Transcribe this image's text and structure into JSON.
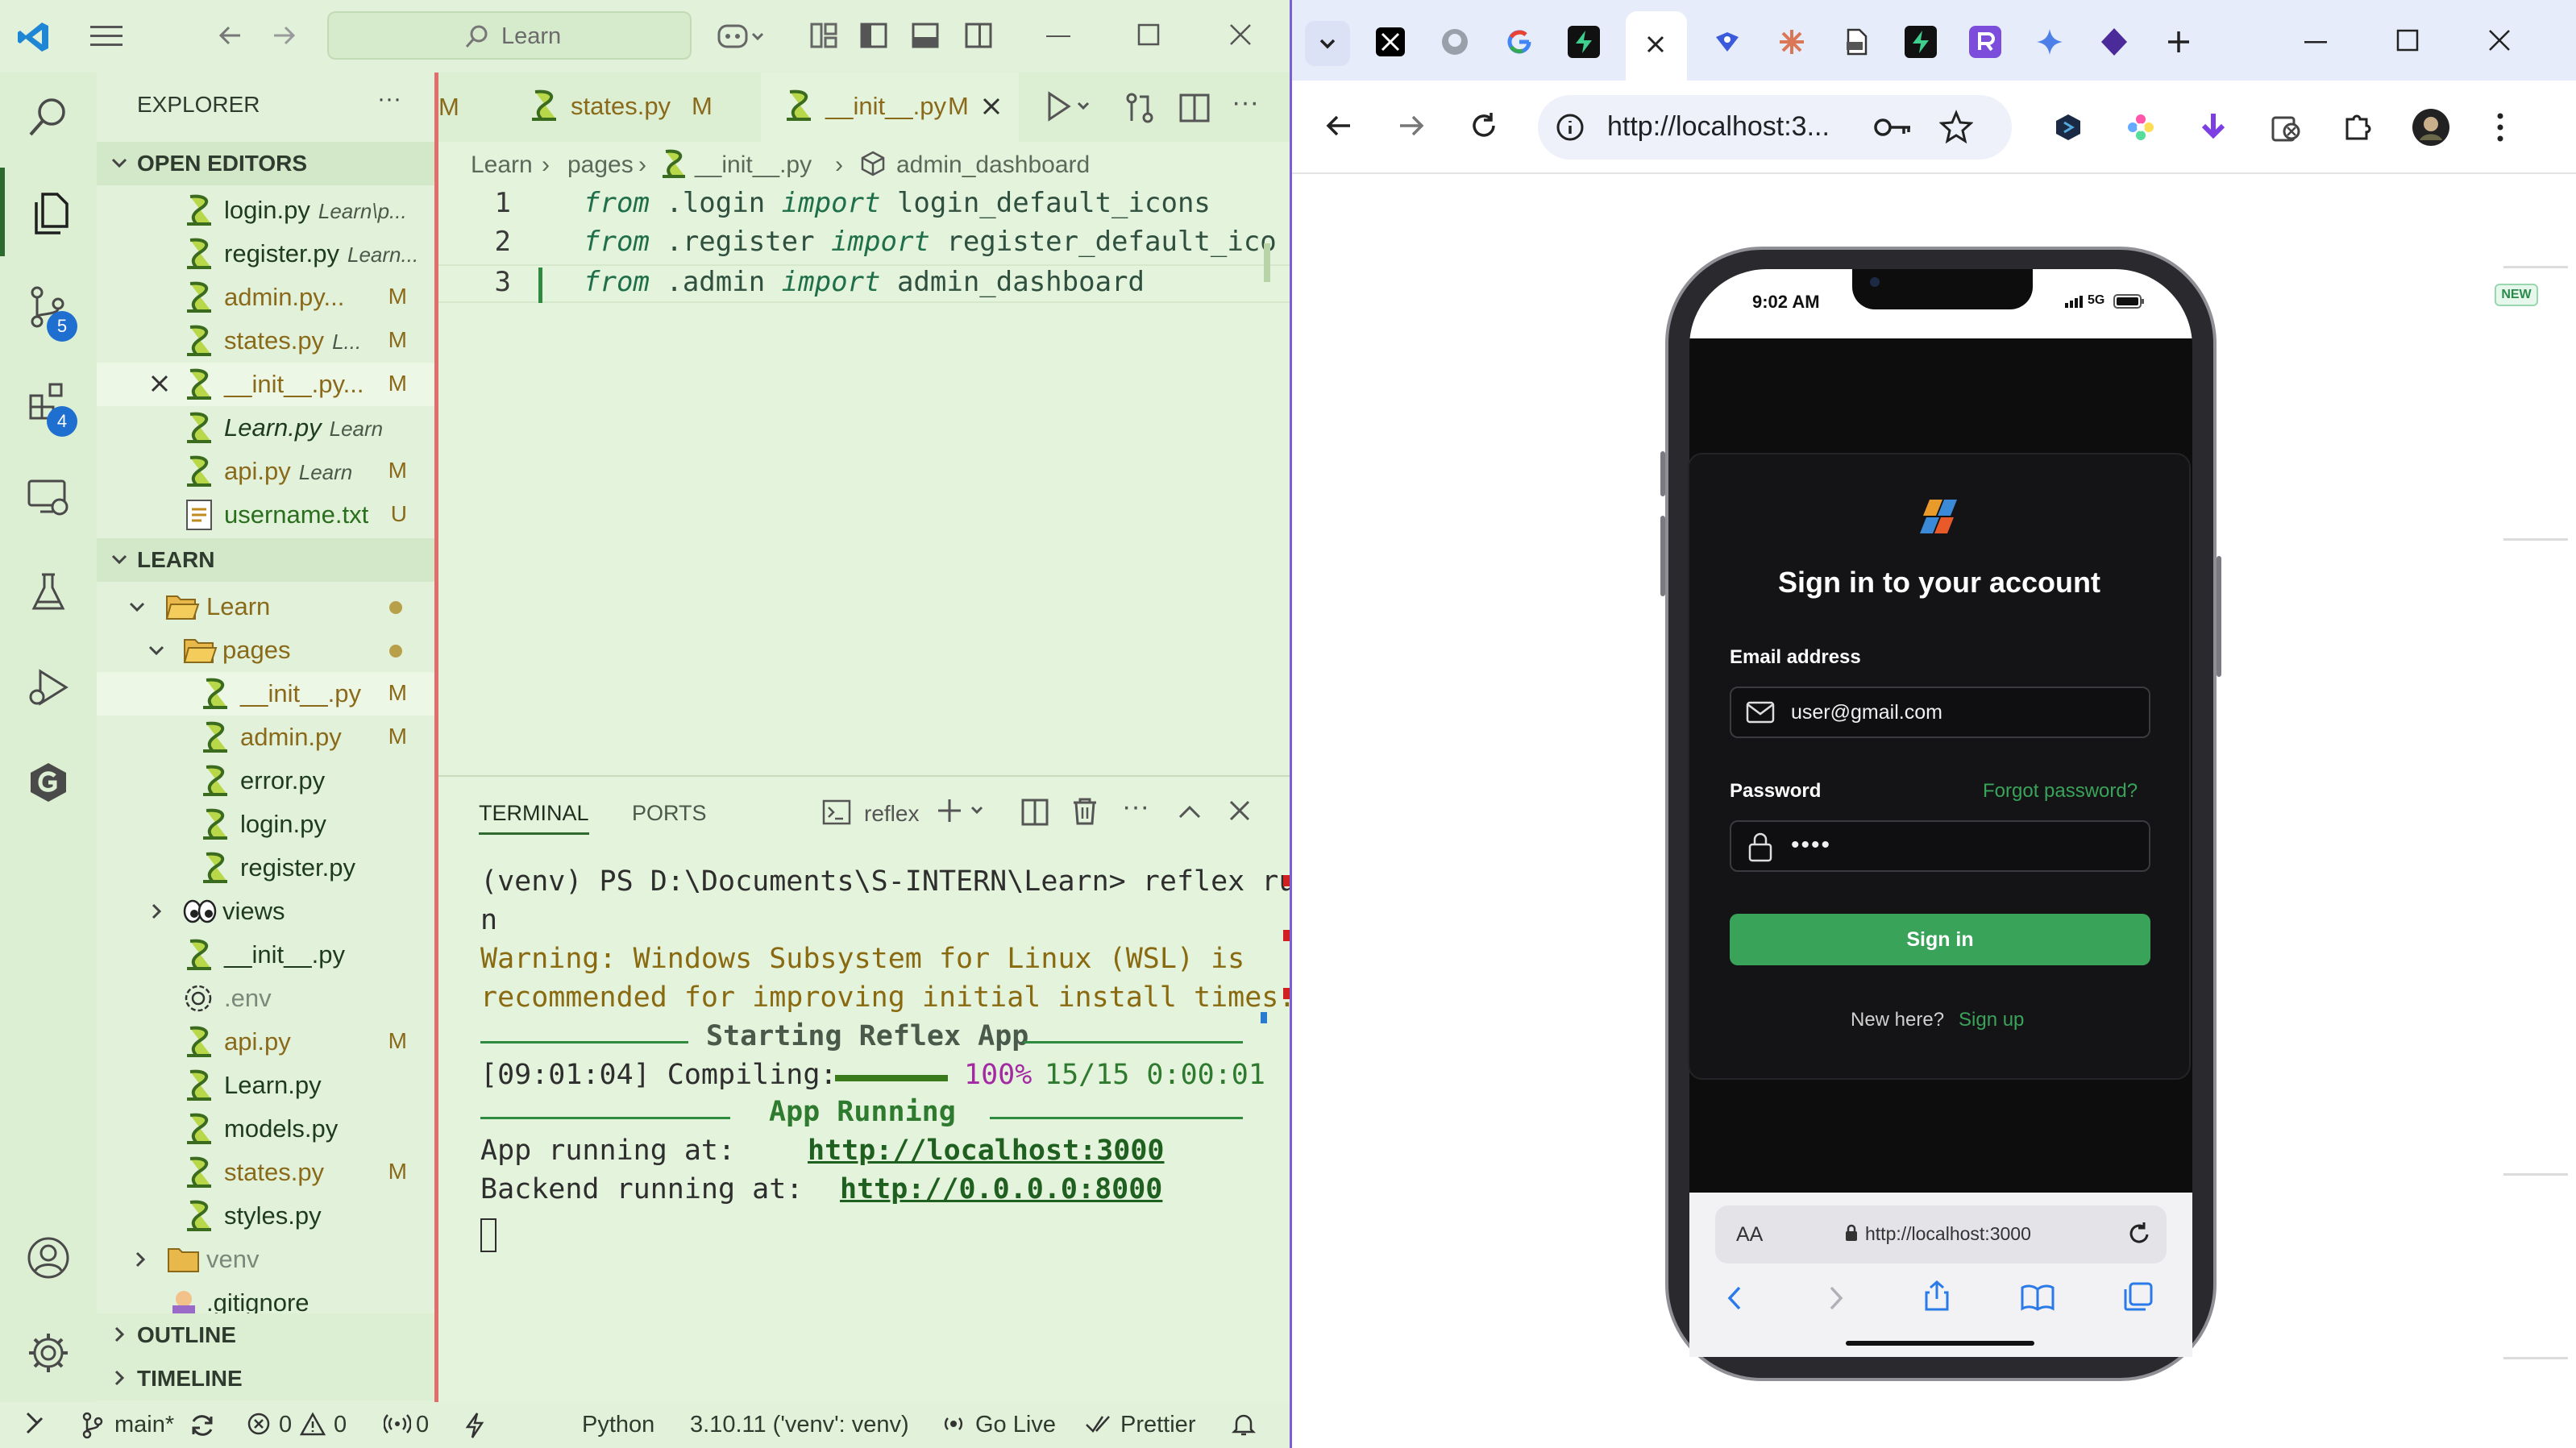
{
  "vscode": {
    "search_placeholder": "Learn",
    "explorer": {
      "title": "EXPLORER",
      "more": "···"
    },
    "badges": {
      "source_control": "5",
      "extensions": "4"
    },
    "open_editors": {
      "title": "OPEN EDITORS",
      "items": [
        {
          "name": "login.py",
          "desc": "Learn\\p...",
          "status": ""
        },
        {
          "name": "register.py",
          "desc": "Learn...",
          "status": ""
        },
        {
          "name": "admin.py...",
          "desc": "",
          "status": "M"
        },
        {
          "name": "states.py",
          "desc": "L...",
          "status": "M"
        },
        {
          "name": "__init__.py...",
          "desc": "",
          "status": "M"
        },
        {
          "name": "Learn.py",
          "desc": "Learn",
          "status": ""
        },
        {
          "name": "api.py",
          "desc": "Learn",
          "status": "M"
        },
        {
          "name": "username.txt",
          "desc": "",
          "status": "U"
        }
      ]
    },
    "learn": {
      "title": "LEARN",
      "items": [
        {
          "name": "Learn",
          "status": ""
        },
        {
          "name": "pages",
          "status": ""
        },
        {
          "name": "__init__.py",
          "status": "M"
        },
        {
          "name": "admin.py",
          "status": "M"
        },
        {
          "name": "error.py",
          "status": ""
        },
        {
          "name": "login.py",
          "status": ""
        },
        {
          "name": "register.py",
          "status": ""
        },
        {
          "name": "views",
          "status": ""
        },
        {
          "name": "__init__.py",
          "status": ""
        },
        {
          "name": ".env",
          "status": ""
        },
        {
          "name": "api.py",
          "status": "M"
        },
        {
          "name": "Learn.py",
          "status": ""
        },
        {
          "name": "models.py",
          "status": ""
        },
        {
          "name": "states.py",
          "status": "M"
        },
        {
          "name": "styles.py",
          "status": ""
        },
        {
          "name": "venv",
          "status": ""
        },
        {
          "name": ".gitignore",
          "status": ""
        }
      ]
    },
    "outline": "OUTLINE",
    "timeline": "TIMELINE",
    "tabs": [
      {
        "name": "M",
        "status": ""
      },
      {
        "name": "states.py",
        "status": "M"
      },
      {
        "name": "__init__.py",
        "status": "M"
      }
    ],
    "breadcrumb": [
      "Learn",
      "pages",
      "__init__.py",
      "admin_dashboard"
    ],
    "code": [
      {
        "n": "1",
        "kw1": "from",
        "mod": " .login ",
        "kw2": "import",
        "name": " login_default_icons"
      },
      {
        "n": "2",
        "kw1": "from",
        "mod": " .register ",
        "kw2": "import",
        "name": " register_default_ico"
      },
      {
        "n": "3",
        "kw1": "from",
        "mod": " .admin ",
        "kw2": "import",
        "name": " admin_dashboard"
      }
    ],
    "panel": {
      "tabs": [
        "TERMINAL",
        "PORTS"
      ],
      "shell": "reflex",
      "lines": {
        "prompt": "(venv) PS D:\\Documents\\S-INTERN\\Learn> reflex ru",
        "prompt_wrap": "n",
        "warn1": "Warning: Windows Subsystem for Linux (WSL) is",
        "warn2": "recommended for improving initial install times.",
        "starting": "Starting Reflex App",
        "compiling": "[09:01:04] Compiling:",
        "percent": "100%",
        "progress_tail": "15/15 0:00:01",
        "app_running": "App Running",
        "app_at": "App running at:",
        "app_url": "http://localhost:3000",
        "backend_at": "Backend running at:",
        "backend_url": "http://0.0.0.0:8000"
      },
      "progress_fraction": 1.0
    },
    "status": {
      "branch": "main*",
      "errors": "0",
      "warnings": "0",
      "ports": "0",
      "language": "Python",
      "interpreter": "3.10.11 ('venv': venv)",
      "golive": "Go Live",
      "prettier": "Prettier"
    }
  },
  "browser": {
    "url": "http://localhost:3...",
    "new_badge": "NEW",
    "phone": {
      "time": "9:02 AM",
      "network": "5G",
      "title": "Sign in to your account",
      "email_label": "Email address",
      "email_value": "user@gmail.com",
      "password_label": "Password",
      "forgot": "Forgot password?",
      "password_value": "••••",
      "signin": "Sign in",
      "new_here": "New here?",
      "signup": "Sign up",
      "aa": "AA",
      "safari_url": "http://localhost:3000"
    }
  },
  "colors": {
    "accent_green": "#3aa35a",
    "vscode_bg": "#e4f3dc",
    "browser_border": "#7b5fd6"
  }
}
